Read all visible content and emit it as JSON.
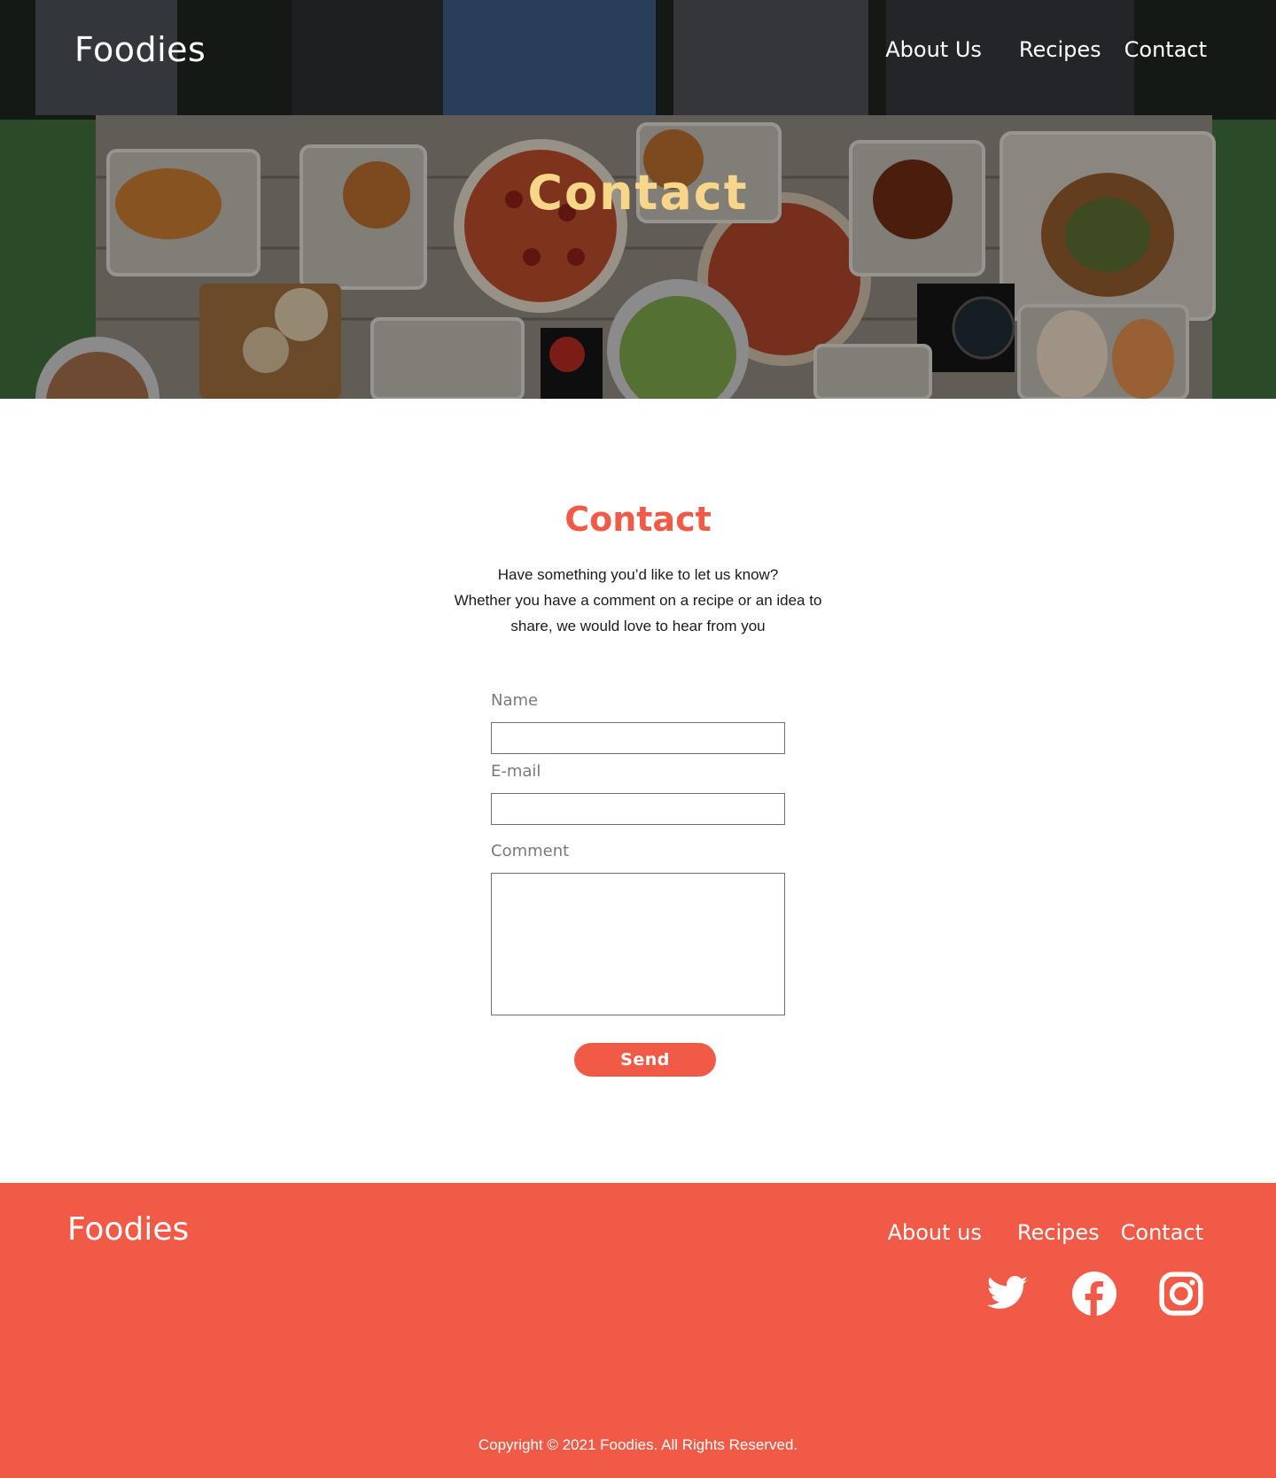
{
  "header": {
    "logo": "Foodies",
    "nav": [
      "About Us",
      "Recipes",
      "Contact"
    ]
  },
  "hero": {
    "title": "Contact"
  },
  "contact": {
    "title": "Contact",
    "intro": [
      "Have something you’d like to let us know?",
      "Whether you have a comment on a recipe or an idea to",
      "share, we would love to hear from you"
    ],
    "name_label": "Name",
    "name_value": "",
    "email_label": "E-mail",
    "email_value": "",
    "comment_label": "Comment",
    "comment_value": "",
    "send_label": "Send"
  },
  "footer": {
    "logo": "Foodies",
    "nav": [
      "About us",
      "Recipes",
      "Contact"
    ],
    "social_icons": [
      "twitter-icon",
      "facebook-icon",
      "instagram-icon"
    ],
    "copyright": "Copyright © 2021 Foodies. All Rights Reserved."
  },
  "colors": {
    "accent": "#f05a47",
    "hero_title": "#f7d68a",
    "label_gray": "#7a7a7a"
  }
}
